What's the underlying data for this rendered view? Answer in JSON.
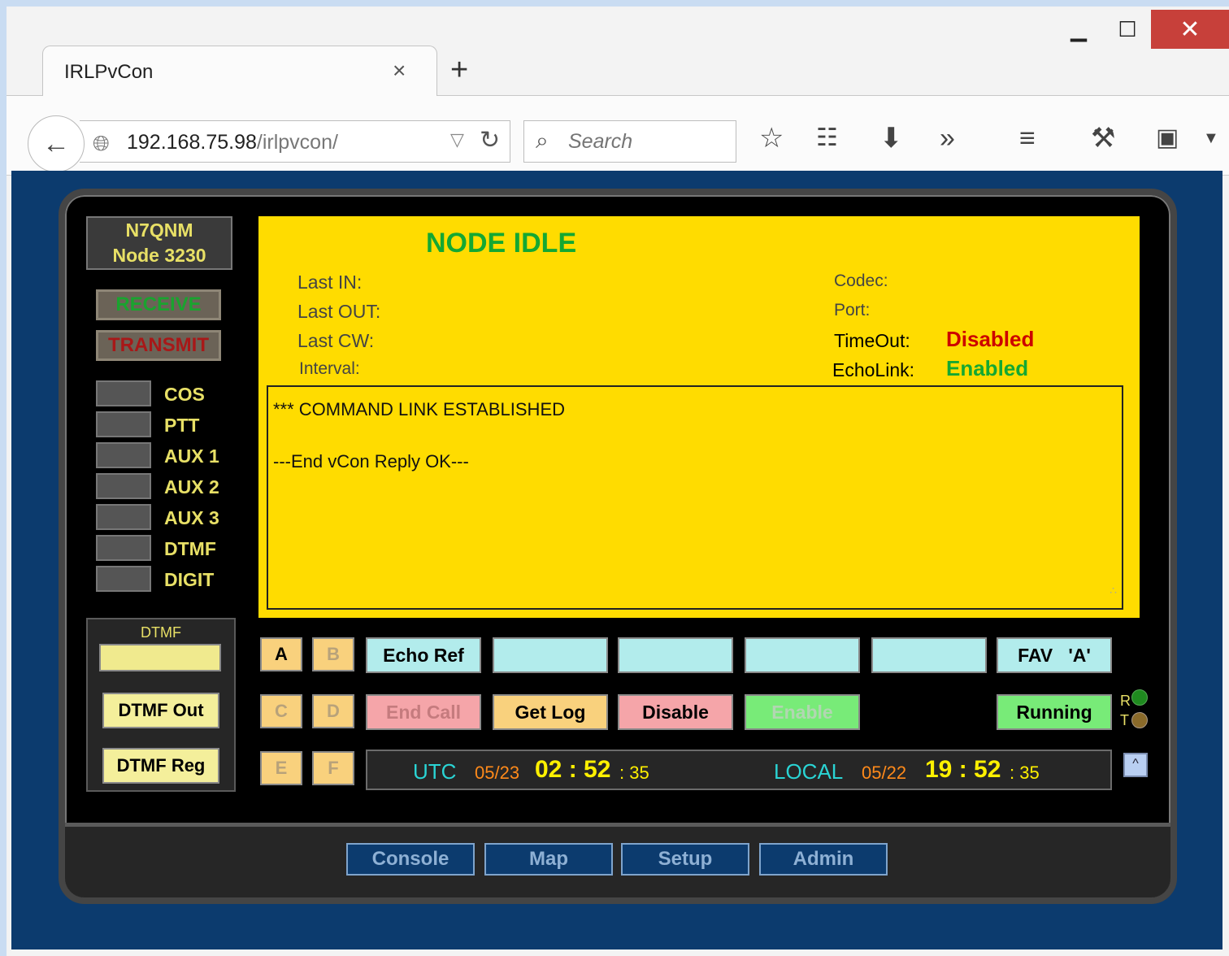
{
  "browser": {
    "tab_title": "IRLPvCon",
    "tab_close": "×",
    "new_tab": "+",
    "url_host": "192.168.75.98",
    "url_path": "/irlpvcon/",
    "search_placeholder": "Search"
  },
  "node": {
    "callsign": "N7QNM",
    "node_label": "Node 3230",
    "receive": "RECEIVE",
    "transmit": "TRANSMIT",
    "status": "NODE IDLE"
  },
  "indicators": [
    "COS",
    "PTT",
    "AUX 1",
    "AUX 2",
    "AUX 3",
    "DTMF",
    "DIGIT"
  ],
  "dtmf": {
    "title": "DTMF",
    "value": "",
    "out_label": "DTMF Out",
    "reg_label": "DTMF Reg"
  },
  "info": {
    "last_in": "Last IN:",
    "last_out": "Last OUT:",
    "last_cw": "Last CW:",
    "interval": "Interval:",
    "codec": "Codec:",
    "port": "Port:",
    "timeout": "TimeOut:",
    "timeout_value": "Disabled",
    "echolink": "EchoLink:",
    "echolink_value": "Enabled"
  },
  "log_lines": [
    "*** COMMAND LINK ESTABLISHED",
    "",
    "---End vCon Reply OK---"
  ],
  "keys": {
    "a": "A",
    "b": "B",
    "c": "C",
    "d": "D",
    "e": "E",
    "f": "F"
  },
  "controls": {
    "echo_ref": "Echo Ref",
    "fav": "FAV   'A'",
    "end_call": "End Call",
    "get_log": "Get Log",
    "disable": "Disable",
    "enable": "Enable",
    "running": "Running",
    "led_r": "R",
    "led_t": "T",
    "arrow": "^"
  },
  "clock": {
    "utc_label": "UTC",
    "utc_date": "05/23",
    "utc_hhmm": "02 : 52",
    "utc_sec": ": 35",
    "local_label": "LOCAL",
    "local_date": "05/22",
    "local_hhmm": "19 : 52",
    "local_sec": ": 35"
  },
  "footer": [
    "Console",
    "Map",
    "Setup",
    "Admin"
  ],
  "colors": {
    "page_bg": "#0c3b6e",
    "status_bg": "#ffdc00",
    "accent_green": "#14a832",
    "accent_red": "#cc0000",
    "label_yellow": "#e8e066"
  }
}
